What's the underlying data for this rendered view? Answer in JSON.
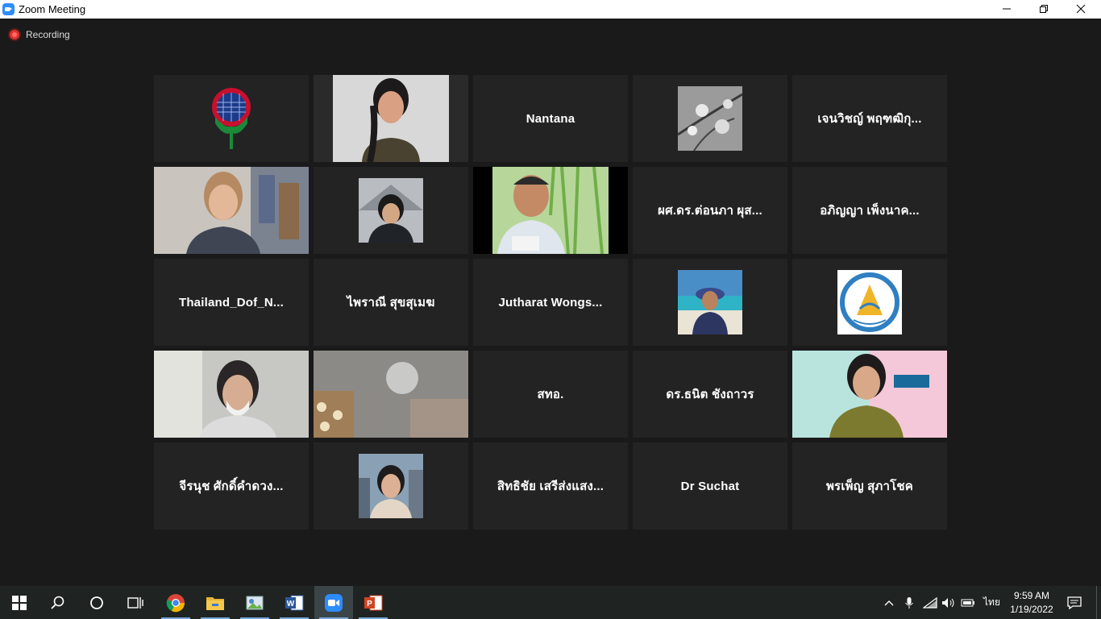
{
  "window": {
    "title": "Zoom Meeting",
    "minimize_icon": "minimize-icon",
    "restore_icon": "restore-icon",
    "close_icon": "close-icon"
  },
  "recording": {
    "label": "Recording",
    "color": "#e0332f"
  },
  "active_speaker_color": "#dfe18c",
  "tiles": [
    {
      "name": "",
      "kind": "logo"
    },
    {
      "name": "",
      "kind": "video",
      "active": true
    },
    {
      "name": "Nantana",
      "kind": "name"
    },
    {
      "name": "",
      "kind": "avatar-photo"
    },
    {
      "name": "เจนวิชญ์ พฤฑฒิกุ...",
      "kind": "name"
    },
    {
      "name": "",
      "kind": "video"
    },
    {
      "name": "",
      "kind": "avatar-photo"
    },
    {
      "name": "",
      "kind": "video"
    },
    {
      "name": "ผศ.ดร.ต่อนภา ผุส...",
      "kind": "name"
    },
    {
      "name": "อภิญญา เพ็งนาค...",
      "kind": "name"
    },
    {
      "name": "Thailand_Dof_N...",
      "kind": "name"
    },
    {
      "name": "ไพราณี สุขสุเมฆ",
      "kind": "name"
    },
    {
      "name": "Jutharat Wongs...",
      "kind": "name"
    },
    {
      "name": "",
      "kind": "avatar-photo"
    },
    {
      "name": "",
      "kind": "logo"
    },
    {
      "name": "",
      "kind": "video"
    },
    {
      "name": "",
      "kind": "video"
    },
    {
      "name": "สทอ.",
      "kind": "name"
    },
    {
      "name": "ดร.ธนิต ชังถาวร",
      "kind": "name"
    },
    {
      "name": "",
      "kind": "video"
    },
    {
      "name": "จีรนุช ศักดิ์คำดวง...",
      "kind": "name"
    },
    {
      "name": "",
      "kind": "avatar-photo"
    },
    {
      "name": "สิทธิชัย เสรีส่งแสง...",
      "kind": "name"
    },
    {
      "name": "Dr Suchat",
      "kind": "name"
    },
    {
      "name": "พรเพ็ญ สุภาโชค",
      "kind": "name"
    }
  ],
  "taskbar": {
    "apps": [
      "start-icon",
      "search-icon",
      "cortana-icon",
      "task-view-icon",
      "chrome-icon",
      "file-explorer-icon",
      "photos-icon",
      "word-icon",
      "zoom-icon",
      "powerpoint-icon"
    ],
    "language": "ไทย",
    "time": "9:59 AM",
    "date": "1/19/2022"
  }
}
